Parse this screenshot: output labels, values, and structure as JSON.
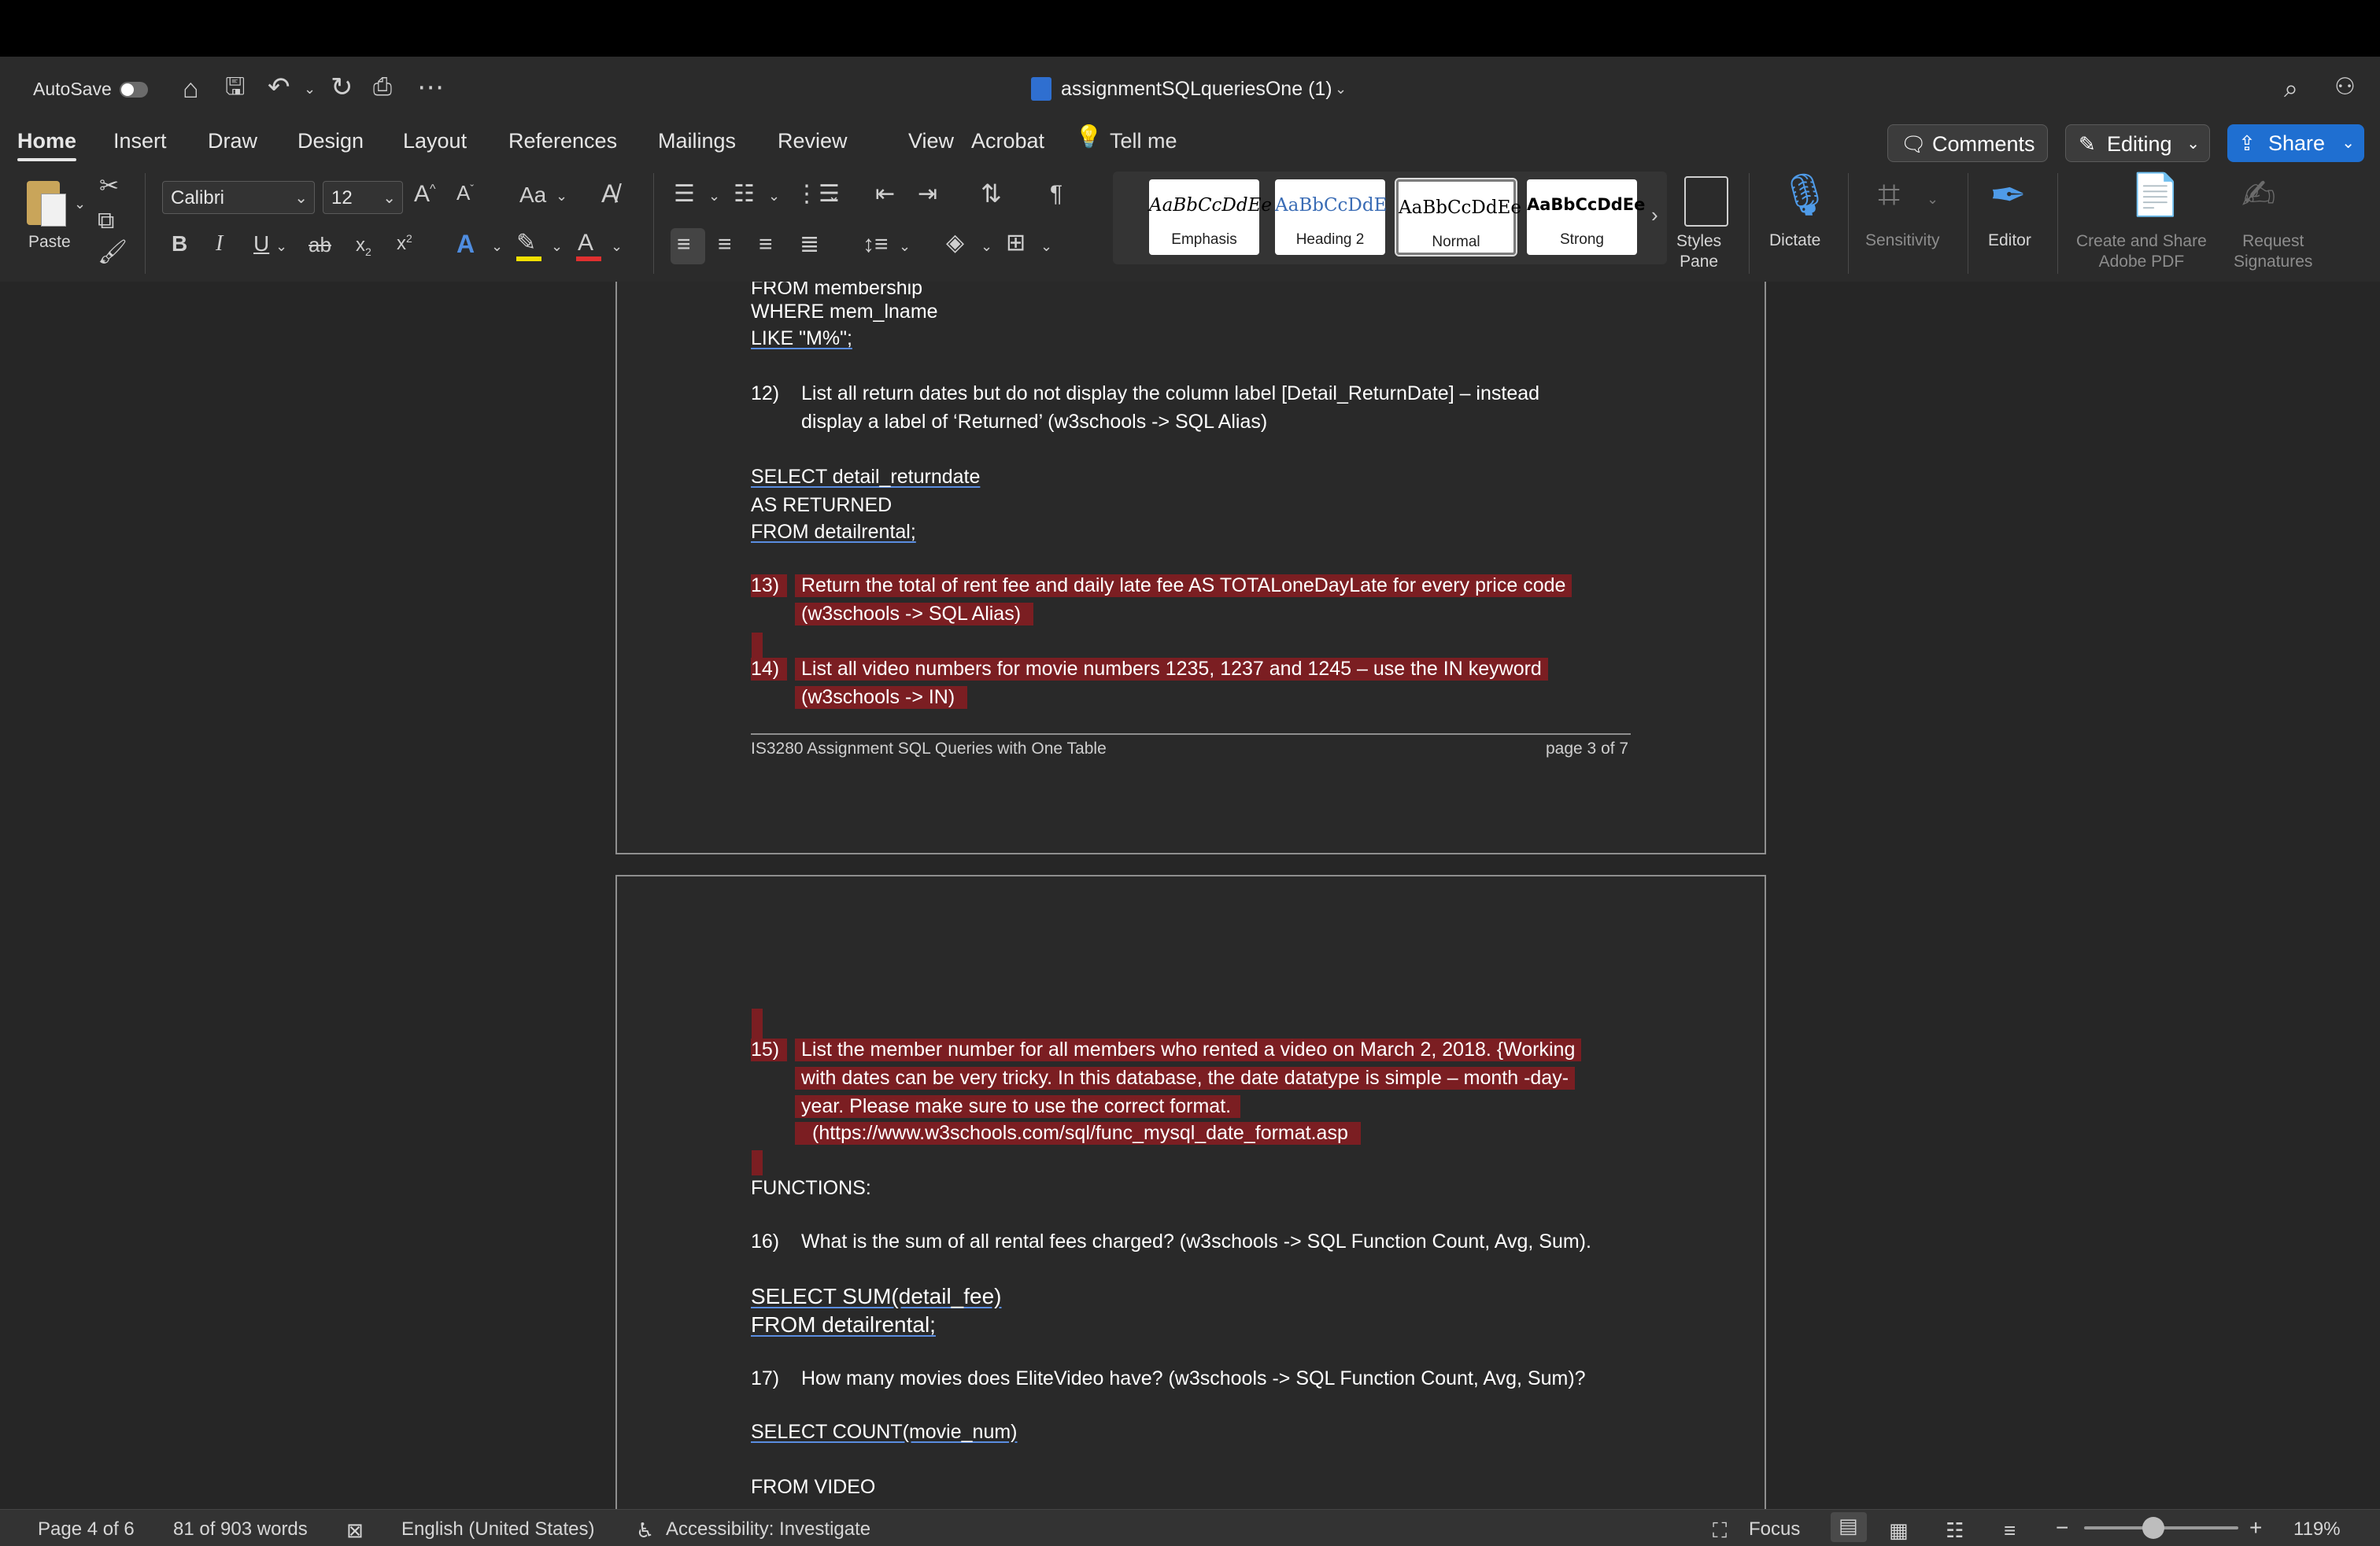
{
  "window": {
    "autosave_label": "AutoSave",
    "doc_title": "assignmentSQLqueriesOne (1)"
  },
  "tabs": [
    "Home",
    "Insert",
    "Draw",
    "Design",
    "Layout",
    "References",
    "Mailings",
    "Review",
    "View",
    "Acrobat"
  ],
  "tell_me": "Tell me",
  "header_buttons": {
    "comments": "Comments",
    "editing": "Editing",
    "share": "Share"
  },
  "ribbon": {
    "paste_label": "Paste",
    "font_name": "Calibri",
    "font_size": "12",
    "change_case_label": "Aa",
    "styles": [
      {
        "sample": "AaBbCcDdEe",
        "label": "Emphasis"
      },
      {
        "sample": "AaBbCcDdE",
        "label": "Heading 2"
      },
      {
        "sample": "AaBbCcDdEe",
        "label": "Normal"
      },
      {
        "sample": "AaBbCcDdEe",
        "label": "Strong"
      }
    ],
    "styles_pane": [
      "Styles",
      "Pane"
    ],
    "dictate": "Dictate",
    "sensitivity": "Sensitivity",
    "editor": "Editor",
    "create_share": [
      "Create and Share",
      "Adobe PDF"
    ],
    "request_sig": [
      "Request",
      "Signatures"
    ],
    "accent_colors": {
      "highlight": "#f2e000",
      "font_color": "#e03030",
      "text_effects": "#4f8de0"
    }
  },
  "page3": {
    "lines": [
      "FROM membership",
      "WHERE mem_lname",
      "LIKE \"M%\";"
    ],
    "q12_num": "12)",
    "q12_l1": "List all return dates but do not display the column label [Detail_ReturnDate] – instead",
    "q12_l2": "display a label of ‘Returned’ (w3schools -> SQL Alias)",
    "sel1": "SELECT detail_returndate",
    "sel2": "AS RETURNED",
    "sel3": "FROM detailrental;",
    "q13_num": "13)",
    "q13_l1": "Return the total of rent fee and daily late fee AS TOTALoneDayLate for every price code",
    "q13_l2": "(w3schools -> SQL Alias)",
    "q14_num": "14)",
    "q14_l1": "List all video numbers for movie numbers 1235, 1237 and 1245 – use the IN keyword",
    "q14_l2": "(w3schools -> IN)",
    "footer_left": "IS3280 Assignment SQL Queries with One Table",
    "footer_right": "page 3 of 7"
  },
  "page4": {
    "q15_num": "15)",
    "q15_l1": "List the member number for all members who rented a video on March 2, 2018.  {Working",
    "q15_l2": "with dates can be very tricky.  In this database, the date datatype is simple – month -day-",
    "q15_l3": "year.  Please make sure to use the correct format.",
    "q15_l4": "(https://www.w3schools.com/sql/func_mysql_date_format.asp",
    "functions": "FUNCTIONS:",
    "q16_num": "16)",
    "q16_l1": "What is the sum of all rental fees charged?  (w3schools -> SQL Function Count, Avg, Sum).",
    "s16_1": "SELECT SUM(detail_fee)",
    "s16_2": "FROM detailrental;",
    "q17_num": "17)",
    "q17_l1": "How many movies does EliteVideo have? (w3schools -> SQL Function Count, Avg, Sum)?",
    "s17_1": "SELECT COUNT(movie_num)",
    "s17_2": "FROM VIDEO"
  },
  "status": {
    "page": "Page 4 of 6",
    "words": "81 of 903 words",
    "language": "English (United States)",
    "accessibility": "Accessibility: Investigate",
    "focus": "Focus",
    "zoom": "119%",
    "zoom_fraction": 0.45
  }
}
